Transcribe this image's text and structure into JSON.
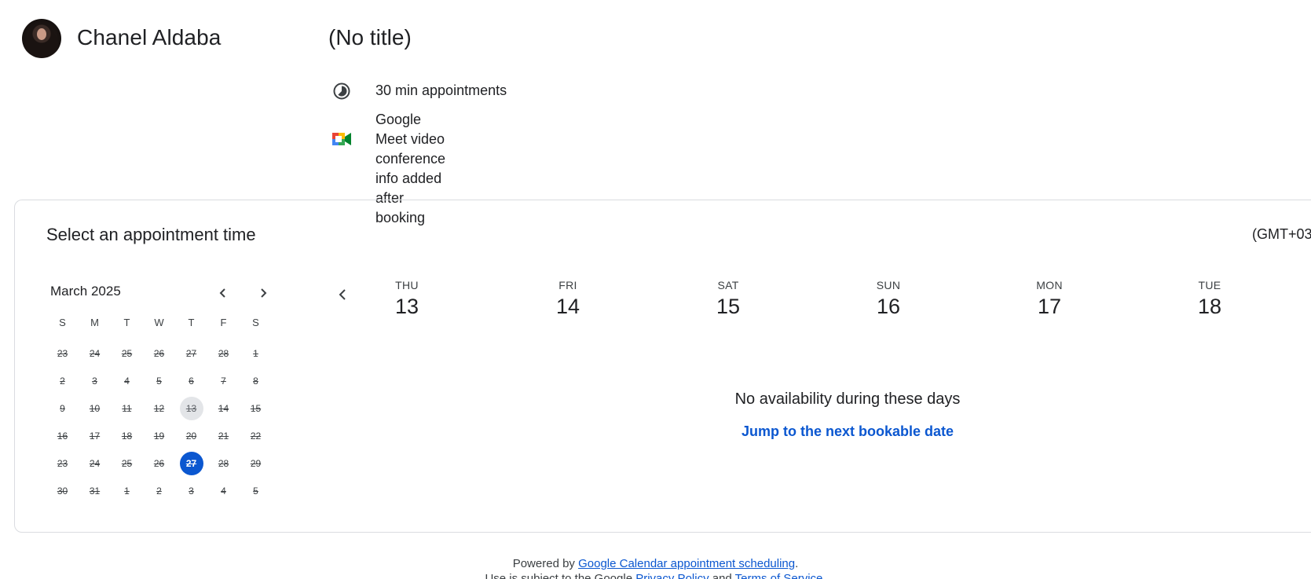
{
  "host": {
    "name": "Chanel Aldaba"
  },
  "event": {
    "title": "(No title)",
    "duration": "30 min appointments",
    "conference": "Google Meet video\nconference info added after\nbooking"
  },
  "panel": {
    "title": "Select an appointment time",
    "timezone": "(GMT+03"
  },
  "mini_calendar": {
    "month": "March 2025",
    "weekdays": [
      "S",
      "M",
      "T",
      "W",
      "T",
      "F",
      "S"
    ],
    "weeks": [
      [
        "23",
        "24",
        "25",
        "26",
        "27",
        "28",
        "1"
      ],
      [
        "2",
        "3",
        "4",
        "5",
        "6",
        "7",
        "8"
      ],
      [
        "9",
        "10",
        "11",
        "12",
        "13",
        "14",
        "15"
      ],
      [
        "16",
        "17",
        "18",
        "19",
        "20",
        "21",
        "22"
      ],
      [
        "23",
        "24",
        "25",
        "26",
        "27",
        "28",
        "29"
      ],
      [
        "30",
        "31",
        "1",
        "2",
        "3",
        "4",
        "5"
      ]
    ],
    "highlighted_date": "13",
    "selected_date": "27"
  },
  "week_view": {
    "days": [
      {
        "name": "THU",
        "num": "13"
      },
      {
        "name": "FRI",
        "num": "14"
      },
      {
        "name": "SAT",
        "num": "15"
      },
      {
        "name": "SUN",
        "num": "16"
      },
      {
        "name": "MON",
        "num": "17"
      },
      {
        "name": "TUE",
        "num": "18"
      }
    ],
    "empty_message": "No availability during these days",
    "jump_link": "Jump to the next bookable date"
  },
  "footer": {
    "powered_by": "Powered by ",
    "link": "Google Calendar appointment scheduling",
    "period": ".",
    "line2_prefix": "Use is subject to the Google ",
    "privacy": "Privacy Policy",
    "and": " and ",
    "terms": "Terms of Service",
    "line2_suffix": "."
  },
  "colors": {
    "accent": "#0b57d0",
    "border": "#dadce0",
    "today_bg": "#e3e5e8"
  }
}
